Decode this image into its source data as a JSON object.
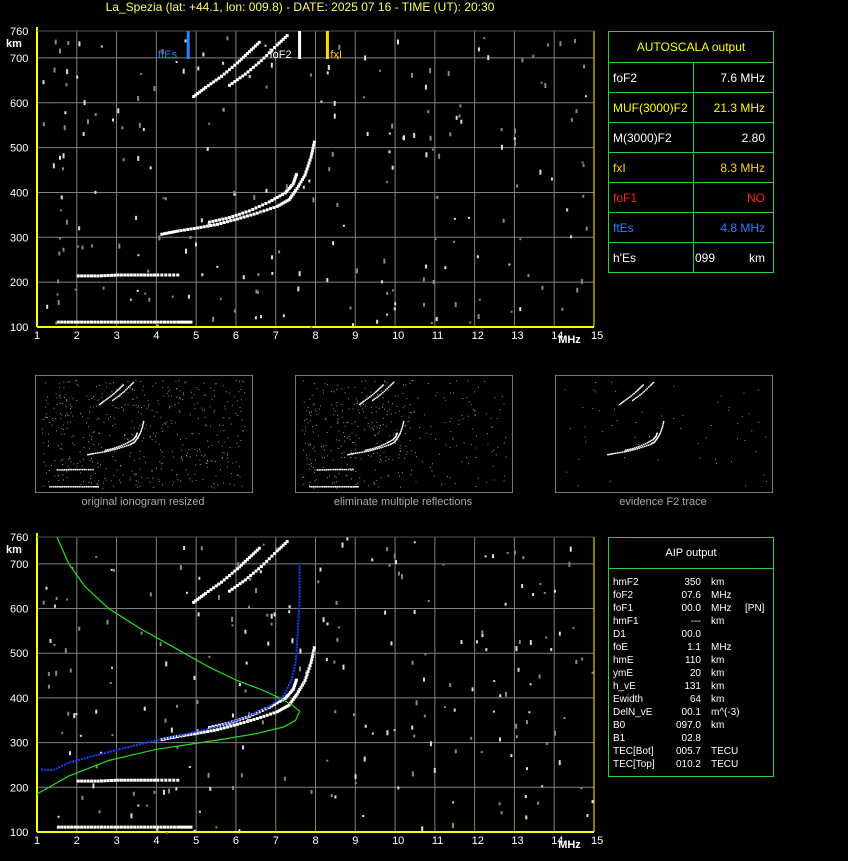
{
  "header": {
    "title": "La_Spezia (lat: +44.1, lon: 009.8) - DATE: 2025 07 16 - TIME (UT): 20:30"
  },
  "colors": {
    "background": "#000000",
    "title": "#ffff60",
    "axis": "#ffff00",
    "grid": "#808080",
    "panel_border": "#2ecc40",
    "ftEs": "#2a7fff",
    "fxI": "#ffd700",
    "foF1": "#ff2020",
    "profile": "#1e3cff",
    "model": "#22dd22"
  },
  "axes": {
    "y_unit": "km",
    "x_unit": "MHz",
    "y_ticks": [
      "760",
      "700",
      "600",
      "500",
      "400",
      "300",
      "200",
      "100"
    ],
    "x_ticks": [
      "1",
      "2",
      "3",
      "4",
      "5",
      "6",
      "7",
      "8",
      "9",
      "10",
      "11",
      "12",
      "13",
      "14",
      "15"
    ]
  },
  "markers": {
    "ftEs": "ftEs",
    "foF2": "foF2",
    "fxI": "fxI"
  },
  "autoscala": {
    "title": "AUTOSCALA output",
    "rows": [
      {
        "key": "foF2",
        "value": "7.6 MHz",
        "color": "#ffffff"
      },
      {
        "key": "MUF(3000)F2",
        "value": "21.3 MHz",
        "color": "#ffff00"
      },
      {
        "key": "M(3000)F2",
        "value": "2.80",
        "color": "#ffffff"
      },
      {
        "key": "fxI",
        "value": "8.3 MHz",
        "color": "#ffd700"
      },
      {
        "key": "foF1",
        "value": "NO",
        "color": "#ff2020"
      },
      {
        "key": "ftEs",
        "value": "4.8 MHz",
        "color": "#2a7fff"
      },
      {
        "key": "h'Es",
        "value": "099",
        "unit": "km",
        "color": "#ffffff"
      }
    ]
  },
  "thumbnails": [
    {
      "caption": "original ionogram resized"
    },
    {
      "caption": "eliminate multiple reflections"
    },
    {
      "caption": "evidence F2 trace"
    }
  ],
  "aip": {
    "title": "AIP output",
    "rows": [
      [
        "hmF2",
        "350",
        "km",
        ""
      ],
      [
        "foF2",
        "07.6",
        "MHz",
        ""
      ],
      [
        "foF1",
        "00.0",
        "MHz",
        "[PN]"
      ],
      [
        "hmF1",
        "---",
        "km",
        ""
      ],
      [
        "D1",
        "00.0",
        "",
        ""
      ],
      [
        "foE",
        "1.1",
        "MHz",
        ""
      ],
      [
        "hmE",
        "110",
        "km",
        ""
      ],
      [
        "ymE",
        "20",
        "km",
        ""
      ],
      [
        "h_vE",
        "131",
        "km",
        ""
      ],
      [
        "Ewidth",
        "64",
        "km",
        ""
      ],
      [
        "DelN_vE",
        "00.1",
        "m^(-3)",
        ""
      ],
      [
        "B0",
        "097.0",
        "km",
        ""
      ],
      [
        "B1",
        "02.8",
        "",
        ""
      ],
      [
        "TEC[Bot]",
        "005.7",
        "TECU",
        ""
      ],
      [
        "TEC[Top]",
        "010.2",
        "TECU",
        ""
      ]
    ]
  },
  "chart_data": [
    {
      "type": "scatter",
      "name": "autoscala ionogram",
      "xlabel": "MHz",
      "ylabel": "km",
      "xlim": [
        1,
        15
      ],
      "ylim": [
        100,
        760
      ],
      "grid": true,
      "vertical_markers": [
        {
          "label": "ftEs",
          "x": 4.8,
          "color": "#2a7fff"
        },
        {
          "label": "foF2",
          "x": 7.6,
          "color": "#ffffff"
        },
        {
          "label": "fxI",
          "x": 8.3,
          "color": "#ffd700"
        }
      ],
      "traces": [
        {
          "role": "Es layer",
          "points": [
            [
              1.5,
              112
            ],
            [
              2.0,
              112
            ],
            [
              2.5,
              112
            ],
            [
              3.0,
              112
            ],
            [
              3.5,
              112
            ],
            [
              4.0,
              112
            ],
            [
              4.5,
              112
            ],
            [
              4.9,
              112
            ]
          ]
        },
        {
          "role": "Es multiple",
          "points": [
            [
              2.0,
              215
            ],
            [
              2.5,
              215
            ],
            [
              3.0,
              217
            ],
            [
              3.5,
              217
            ],
            [
              4.0,
              217
            ],
            [
              4.6,
              217
            ]
          ]
        },
        {
          "role": "F2 ordinary",
          "points": [
            [
              4.1,
              308
            ],
            [
              4.5,
              315
            ],
            [
              5.0,
              322
            ],
            [
              5.5,
              330
            ],
            [
              6.0,
              342
            ],
            [
              6.5,
              355
            ],
            [
              7.0,
              370
            ],
            [
              7.3,
              385
            ],
            [
              7.5,
              410
            ],
            [
              7.7,
              440
            ],
            [
              7.85,
              480
            ],
            [
              7.95,
              520
            ]
          ]
        },
        {
          "role": "F2 extraordinary",
          "points": [
            [
              5.3,
              335
            ],
            [
              5.8,
              345
            ],
            [
              6.3,
              360
            ],
            [
              6.8,
              380
            ],
            [
              7.2,
              400
            ],
            [
              7.4,
              420
            ],
            [
              7.5,
              445
            ]
          ]
        },
        {
          "role": "F2 multiple",
          "points": [
            [
              4.9,
              615
            ],
            [
              5.2,
              635
            ],
            [
              5.6,
              660
            ],
            [
              6.0,
              690
            ],
            [
              6.3,
              715
            ],
            [
              6.6,
              740
            ]
          ]
        },
        {
          "role": "F2 multiple x",
          "points": [
            [
              5.8,
              640
            ],
            [
              6.2,
              665
            ],
            [
              6.6,
              695
            ],
            [
              7.0,
              730
            ],
            [
              7.3,
              755
            ]
          ]
        }
      ]
    },
    {
      "type": "scatter",
      "name": "aip ionogram",
      "xlabel": "MHz",
      "ylabel": "km",
      "xlim": [
        1,
        15
      ],
      "ylim": [
        100,
        760
      ],
      "grid": true,
      "traces": [
        {
          "role": "Es layer",
          "points": [
            [
              1.5,
              112
            ],
            [
              2.0,
              112
            ],
            [
              2.5,
              112
            ],
            [
              3.0,
              112
            ],
            [
              3.5,
              112
            ],
            [
              4.0,
              112
            ],
            [
              4.5,
              112
            ],
            [
              4.9,
              112
            ]
          ]
        },
        {
          "role": "Es multiple",
          "points": [
            [
              2.0,
              215
            ],
            [
              2.5,
              215
            ],
            [
              3.0,
              217
            ],
            [
              3.5,
              217
            ],
            [
              4.0,
              217
            ],
            [
              4.6,
              217
            ]
          ]
        },
        {
          "role": "F2 ordinary",
          "points": [
            [
              4.1,
              308
            ],
            [
              4.5,
              315
            ],
            [
              5.0,
              322
            ],
            [
              5.5,
              330
            ],
            [
              6.0,
              342
            ],
            [
              6.5,
              355
            ],
            [
              7.0,
              370
            ],
            [
              7.3,
              385
            ],
            [
              7.5,
              410
            ],
            [
              7.7,
              440
            ],
            [
              7.85,
              480
            ],
            [
              7.95,
              520
            ]
          ]
        },
        {
          "role": "F2 extraordinary",
          "points": [
            [
              5.3,
              335
            ],
            [
              5.8,
              345
            ],
            [
              6.3,
              360
            ],
            [
              6.8,
              380
            ],
            [
              7.2,
              400
            ],
            [
              7.4,
              420
            ],
            [
              7.5,
              445
            ]
          ]
        },
        {
          "role": "F2 multiple",
          "points": [
            [
              4.9,
              615
            ],
            [
              5.2,
              635
            ],
            [
              5.6,
              660
            ],
            [
              6.0,
              690
            ],
            [
              6.3,
              715
            ],
            [
              6.6,
              740
            ]
          ]
        },
        {
          "role": "F2 multiple x",
          "points": [
            [
              5.8,
              640
            ],
            [
              6.2,
              665
            ],
            [
              6.6,
              695
            ],
            [
              7.0,
              730
            ],
            [
              7.3,
              755
            ]
          ]
        }
      ],
      "profile_line": {
        "color": "#1e3cff",
        "points": [
          [
            1.1,
            240
          ],
          [
            1.4,
            238
          ],
          [
            1.8,
            255
          ],
          [
            2.5,
            272
          ],
          [
            3.2,
            288
          ],
          [
            4.0,
            305
          ],
          [
            4.8,
            320
          ],
          [
            5.5,
            335
          ],
          [
            6.2,
            355
          ],
          [
            6.8,
            378
          ],
          [
            7.2,
            405
          ],
          [
            7.4,
            440
          ],
          [
            7.5,
            480
          ],
          [
            7.55,
            540
          ],
          [
            7.6,
            620
          ],
          [
            7.6,
            700
          ]
        ]
      },
      "model_curves": [
        {
          "color": "#22dd22",
          "points": [
            [
              1.5,
              760
            ],
            [
              1.8,
              700
            ],
            [
              2.2,
              650
            ],
            [
              2.8,
              600
            ],
            [
              3.6,
              555
            ],
            [
              4.5,
              510
            ],
            [
              5.3,
              470
            ],
            [
              6.0,
              440
            ],
            [
              6.6,
              420
            ],
            [
              7.1,
              400
            ],
            [
              7.4,
              385
            ],
            [
              7.6,
              370
            ],
            [
              7.5,
              350
            ],
            [
              7.2,
              335
            ],
            [
              6.5,
              320
            ],
            [
              5.5,
              305
            ],
            [
              4.0,
              285
            ],
            [
              2.8,
              260
            ],
            [
              1.8,
              225
            ],
            [
              1.0,
              185
            ]
          ]
        }
      ]
    }
  ]
}
